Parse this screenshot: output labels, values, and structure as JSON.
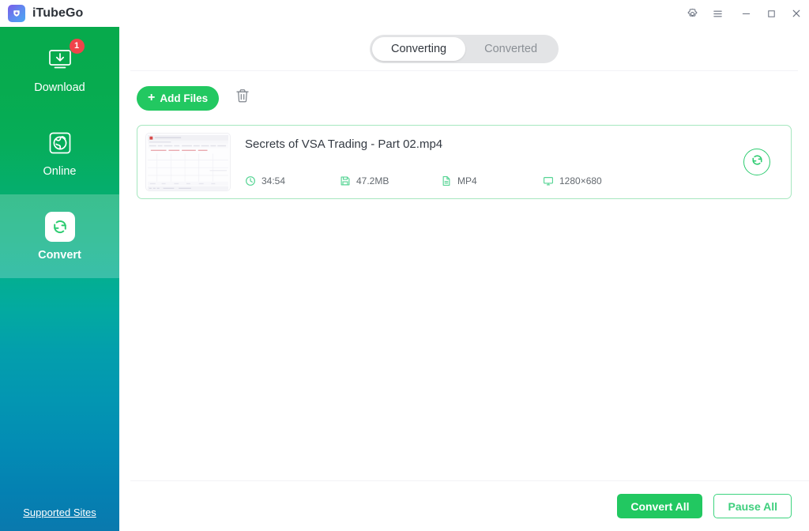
{
  "window": {
    "brand": "iTubeGo",
    "brand_logo_icon": "download-arrow-logo-icon",
    "controls": [
      {
        "name": "settings-button",
        "icon": "gear-icon",
        "glyph": ""
      },
      {
        "name": "menu-button",
        "icon": "hamburger-menu-icon",
        "glyph": ""
      },
      {
        "name": "minimize-button",
        "icon": "minimize-icon",
        "glyph": ""
      },
      {
        "name": "maximize-button",
        "icon": "maximize-icon",
        "glyph": ""
      },
      {
        "name": "close-button",
        "icon": "close-icon",
        "glyph": ""
      }
    ]
  },
  "sidebar": {
    "items": [
      {
        "label": "Download",
        "icon": "download-monitor-icon",
        "badge": "1",
        "active": false
      },
      {
        "label": "Online",
        "icon": "globe-icon",
        "badge": "",
        "active": false
      },
      {
        "label": "Convert",
        "icon": "convert-refresh-icon",
        "badge": "",
        "active": true
      }
    ],
    "footer_link": "Supported Sites"
  },
  "tabs": [
    {
      "label": "Converting",
      "active": true
    },
    {
      "label": "Converted",
      "active": false
    }
  ],
  "toolbar": {
    "add_files_label": "Add Files",
    "add_files_plus": "+",
    "delete_icon": "trash-icon"
  },
  "files": [
    {
      "title": "Secrets of VSA Trading - Part 02.mp4",
      "duration": "34:54",
      "size": "47.2MB",
      "format": "MP4",
      "resolution": "1280×680",
      "duration_icon": "clock-icon",
      "size_icon": "floppy-disk-icon",
      "format_icon": "file-document-icon",
      "resolution_icon": "monitor-icon",
      "action_icon": "convert-refresh-circle-icon"
    }
  ],
  "footer": {
    "convert_all_label": "Convert All",
    "pause_all_label": "Pause All"
  },
  "colors": {
    "accent_green": "#22C861",
    "card_border_green": "#A6E7BF",
    "meta_icon_green": "#56D494",
    "badge_red": "#F0434A",
    "sidebar_top": "#07AA4C",
    "sidebar_bottom": "#0A79AE"
  }
}
